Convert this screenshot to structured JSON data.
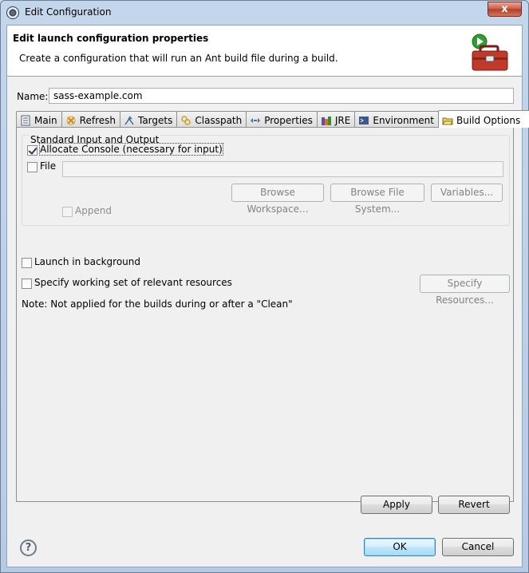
{
  "window": {
    "title": "Edit Configuration",
    "close_glyph": "x"
  },
  "banner": {
    "title": "Edit launch configuration properties",
    "description": "Create a configuration that will run an Ant build file during a build."
  },
  "name_field": {
    "label": "Name:",
    "value": "sass-example.com"
  },
  "tabs": [
    {
      "label": "Main",
      "icon": "main-page-icon"
    },
    {
      "label": "Refresh",
      "icon": "refresh-icon"
    },
    {
      "label": "Targets",
      "icon": "targets-icon"
    },
    {
      "label": "Classpath",
      "icon": "classpath-icon"
    },
    {
      "label": "Properties",
      "icon": "properties-icon"
    },
    {
      "label": "JRE",
      "icon": "jre-icon"
    },
    {
      "label": "Environment",
      "icon": "environment-icon"
    },
    {
      "label": "Build Options",
      "icon": "build-options-icon",
      "active": true
    }
  ],
  "build_options": {
    "group_label": "Standard Input and Output",
    "allocate_console": {
      "label": "Allocate Console (necessary for input)",
      "checked": true
    },
    "file": {
      "label": "File",
      "checked": false,
      "value": ""
    },
    "browse_workspace": "Browse Workspace...",
    "browse_file_system": "Browse File System...",
    "variables": "Variables...",
    "append": {
      "label": "Append",
      "checked": false
    },
    "launch_background": {
      "label": "Launch in background",
      "checked": false
    },
    "working_set": {
      "label": "Specify working set of relevant resources",
      "checked": false
    },
    "specify_resources": "Specify Resources...",
    "note": "Note: Not applied for the builds during or after a \"Clean\""
  },
  "buttons": {
    "apply": "Apply",
    "revert": "Revert",
    "ok": "OK",
    "cancel": "Cancel"
  },
  "help_glyph": "?",
  "colors": {
    "titlebar": "#c4d6ec",
    "close": "#c75947",
    "default_button": "#3c7fb1"
  }
}
